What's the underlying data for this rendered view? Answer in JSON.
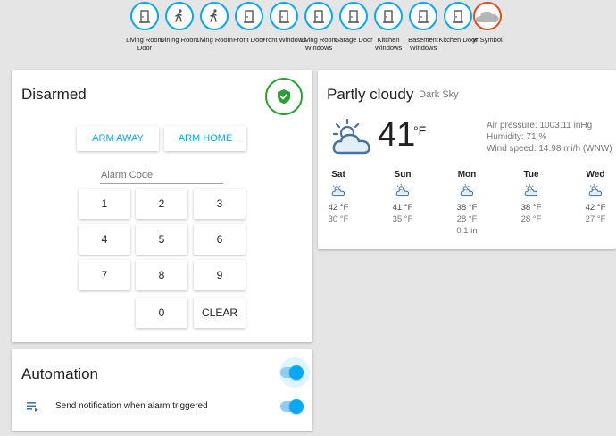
{
  "badges": [
    {
      "label": "Living Room Door",
      "icon": "door-icon"
    },
    {
      "label": "Dining Room",
      "icon": "walking-person-icon"
    },
    {
      "label": "Living Room",
      "icon": "walking-person-icon"
    },
    {
      "label": "Front Door",
      "icon": "door-icon"
    },
    {
      "label": "Front Windows",
      "icon": "door-icon"
    },
    {
      "label": "Living Room Windows",
      "icon": "door-icon"
    },
    {
      "label": "Garage Door",
      "icon": "door-icon"
    },
    {
      "label": "Kitchen Windows",
      "icon": "door-icon"
    },
    {
      "label": "Basement Windows",
      "icon": "door-icon"
    },
    {
      "label": "Kitchen Door",
      "icon": "door-icon"
    },
    {
      "label": "yr Symbol",
      "icon": "cloud-icon"
    }
  ],
  "alarm": {
    "state": "Disarmed",
    "arm_away_label": "ARM AWAY",
    "arm_home_label": "ARM HOME",
    "code_label": "Alarm Code",
    "keys": [
      "1",
      "2",
      "3",
      "4",
      "5",
      "6",
      "7",
      "8",
      "9",
      "0"
    ],
    "clear_label": "CLEAR",
    "status_icon": "shield-check-icon",
    "status_color": "#2c9e34"
  },
  "automation": {
    "title": "Automation",
    "toggle_on": true,
    "item_label": "Send notification when alarm triggered",
    "item_icon": "playlist-icon",
    "item_on": true
  },
  "weather": {
    "condition": "Partly cloudy",
    "source": "Dark Sky",
    "temp": "41",
    "unit": "°F",
    "pressure": "Air pressure: 1003.11 inHg",
    "humidity": "Humidity: 71 %",
    "wind": "Wind speed: 14.98 mi/h (WNW)",
    "forecast": [
      {
        "day": "Sat",
        "high": "42 °F",
        "low": "30 °F",
        "precip": ""
      },
      {
        "day": "Sun",
        "high": "41 °F",
        "low": "35 °F",
        "precip": ""
      },
      {
        "day": "Mon",
        "high": "38 °F",
        "low": "28 °F",
        "precip": "0.1 in"
      },
      {
        "day": "Tue",
        "high": "38 °F",
        "low": "28 °F",
        "precip": ""
      },
      {
        "day": "Wed",
        "high": "42 °F",
        "low": "27 °F",
        "precip": ""
      }
    ]
  },
  "colors": {
    "accent": "#03a9f4",
    "badge_alert": "#df4c1e",
    "background": "#e5e5e5"
  }
}
